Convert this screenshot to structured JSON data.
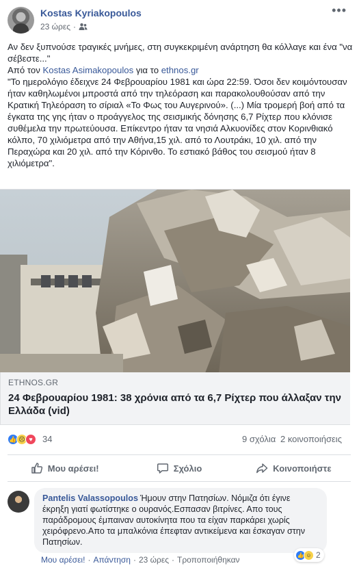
{
  "post": {
    "author": "Kostas Kyriakopoulos",
    "time": "23 ώρες",
    "audience_icon": "friends-icon",
    "more_icon": "ellipsis-icon",
    "intro": "Αν δεν ξυπνούσε τραγικές μνήμες, στη συγκεκριμένη ανάρτηση θα κόλλαγε και ένα \"να σέβεστε...\"",
    "from_prefix": "Από τον",
    "from_person": "Kostas Asimakopoulos",
    "from_mid": "για το",
    "from_site": "ethnos.gr",
    "quote": "\"Το ημερολόγιο έδειχνε 24 Φεβρουαρίου 1981 και ώρα 22:59. Όσοι δεν κοιμόντουσαν ήταν καθηλωμένοι μπροστά από την τηλεόραση και παρακολουθούσαν από την Κρατική Τηλεόραση το σίριαλ «Το Φως του Αυγερινού». (...) Μία τρομερή βοή από τα έγκατα της γης ήταν ο προάγγελος της σεισμικής δόνησης 6,7 Ρίχτερ που κλόνισε συθέμελα την πρωτεύουσα. Επίκεντρο ήταν τα νησιά Αλκυονίδες στον Κορινθιακό κόλπο, 70 χιλιόμετρα από την Αθήνα,15 χιλ. από το Λουτράκι, 10 χιλ. από την Περαχώρα και 20 χιλ. από την Κόρινθο. Το εστιακό βάθος του σεισμού ήταν 8 χιλιόμετρα\"."
  },
  "link_preview": {
    "domain": "ETHNOS.GR",
    "headline": "24 Φεβρουαρίου 1981: 38 χρόνια από τα 6,7 Ρίχτερ που άλλαξαν την Ελλάδα (vid)"
  },
  "stats": {
    "reactions": "34",
    "comments": "9 σχόλια",
    "shares": "2 κοινοποιήσεις"
  },
  "actions": {
    "like": "Μου αρέσει!",
    "comment": "Σχόλιο",
    "share": "Κοινοποιήστε"
  },
  "comment": {
    "author": "Pantelis Valassopoulos",
    "text": "Ήμουν στην Πατησίων. Νόμιζα ότι έγινε έκρηξη γιατί φωτίστηκε ο ουρανός.Εσπασαν βιτρίνες. Απο τους παράδρομους έμπαιναν αυτοκίνητα που τα είχαν παρκάρει χωρίς χειρόφρενο.Απο τα μπαλκόνια έπεφταν αντικείμενα και έσκαγαν στην Πατησίων.",
    "reaction_count": "2",
    "like_link": "Μου αρέσει!",
    "reply_link": "Απάντηση",
    "time": "23 ώρες",
    "edited": "Τροποποιήθηκαν",
    "sep": "·"
  },
  "colors": {
    "link_blue": "#385898",
    "like_blue": "#2f7cf6",
    "love_red": "#f0475c",
    "sad_yellow": "#f7d149"
  }
}
